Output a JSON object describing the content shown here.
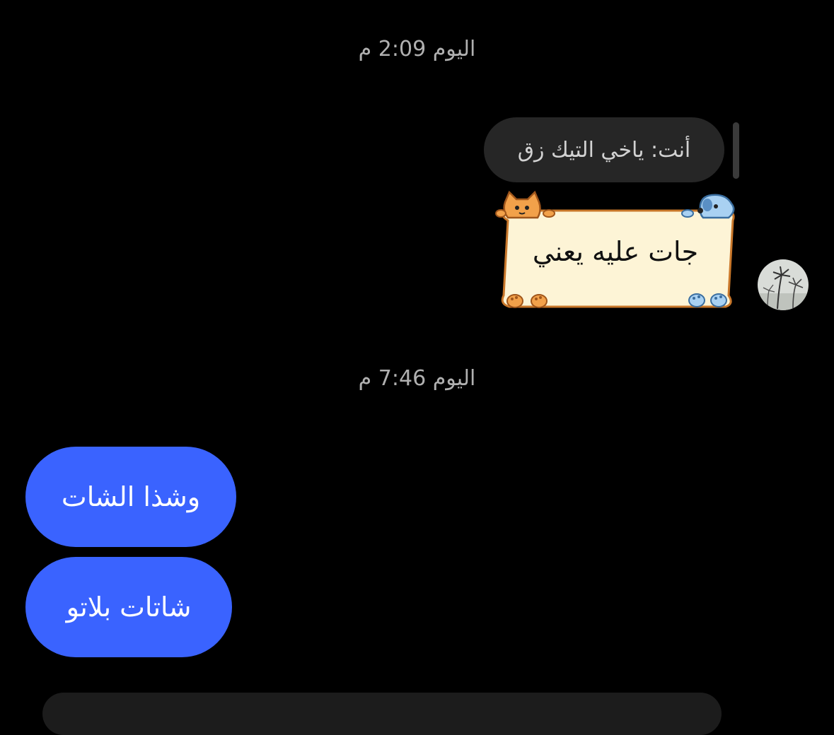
{
  "timestamps": {
    "first": "اليوم 2:09 م",
    "second": "اليوم 7:46 م"
  },
  "reply": {
    "text": "أنت: ياخي التيك زق"
  },
  "note_message": {
    "text": "جات عليه يعني",
    "decorations": [
      "orange-cat-icon",
      "blue-dog-icon",
      "orange-paw-icon",
      "blue-paw-icon"
    ]
  },
  "messages": [
    {
      "text": "وشذا الشات"
    },
    {
      "text": "شاتات بلاتو"
    }
  ],
  "colors": {
    "background": "#000000",
    "outgoing_bubble": "#3a63ff",
    "reply_bubble": "#262626",
    "note_fill": "#fdf4d6",
    "note_border": "#c9772a",
    "timestamp": "#b0b0b0"
  }
}
